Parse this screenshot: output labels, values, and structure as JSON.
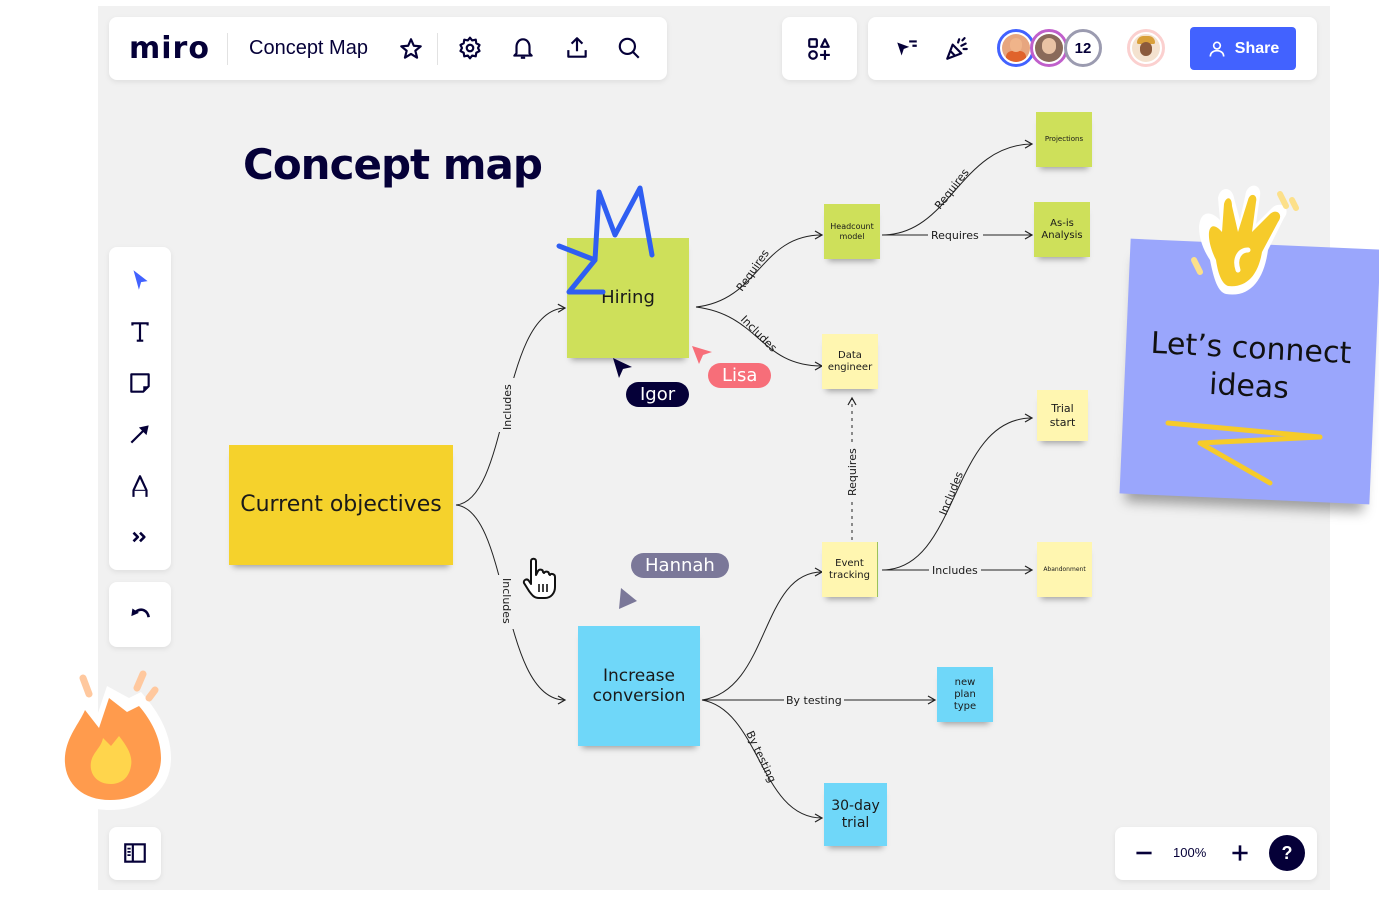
{
  "app": {
    "logo": "miro",
    "board_title": "Concept Map"
  },
  "toolbar": {
    "top_left_icons": [
      "star-icon",
      "settings-icon",
      "notifications-icon",
      "upload-icon",
      "search-icon"
    ],
    "shapes_icon": "shapes-icon",
    "top_right_icons": [
      "cursor-filter-icon",
      "celebrate-icon"
    ],
    "collaborators_count": "12",
    "share_label": "Share"
  },
  "colors": {
    "accent": "#4262ff",
    "ink": "#050038",
    "sticky_green": "#cee05a",
    "sticky_light_yellow": "#fff6b0",
    "sticky_yellow": "#f5d22c",
    "sticky_blue": "#6fd7f9",
    "sticky_purple": "#9aa6fc",
    "cursor_igor": "#050038",
    "cursor_lisa": "#f76e79",
    "cursor_hannah": "#7b7899"
  },
  "left_toolbar": {
    "tools": [
      "select-tool",
      "text-tool",
      "sticky-note-tool",
      "connection-line-tool",
      "pen-tool",
      "more-tools"
    ],
    "undo": "undo"
  },
  "canvas": {
    "title": "Concept map",
    "nodes": {
      "current_objectives": "Current objectives",
      "hiring": "Hiring",
      "increase_conversion": "Increase conversion",
      "headcount_model": "Headcount model",
      "projections": "Projections",
      "as_is_analysis": "As-is Analysis",
      "data_engineer": "Data engineer",
      "trial_start": "Trial start",
      "event_tracking": "Event tracking",
      "abandonment": "Abandonment",
      "new_plan_type": "new plan type",
      "thirty_day_trial": "30-day trial"
    },
    "edges": {
      "objectives_to_hiring": "Includes",
      "objectives_to_conversion": "Includes",
      "hiring_to_headcount": "Requires",
      "hiring_to_data_engineer": "Includes",
      "headcount_to_projections": "Requires",
      "headcount_to_asis": "Requires",
      "event_to_data_engineer": "Requires",
      "event_to_trial_start": "Includes",
      "event_to_abandonment": "Includes",
      "conversion_to_new_plan": "By testing",
      "conversion_to_trial": "By testing"
    },
    "cursors": {
      "igor": "Igor",
      "lisa": "Lisa",
      "hannah": "Hannah"
    },
    "callout_note": "Let’s connect ideas"
  },
  "zoom_controls": {
    "zoom_level": "100%",
    "help": "?"
  }
}
